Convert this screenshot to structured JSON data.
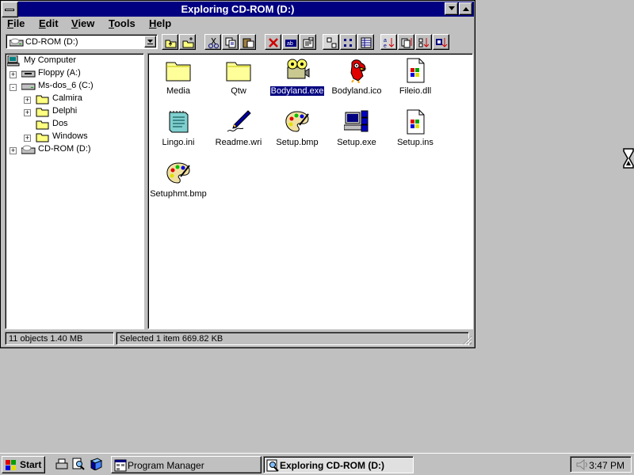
{
  "window": {
    "title": "Exploring CD-ROM (D:)",
    "accent": "#000080"
  },
  "menu": [
    "File",
    "Edit",
    "View",
    "Tools",
    "Help"
  ],
  "toolbar": {
    "drive_value": "CD-ROM (D:)"
  },
  "tree": [
    {
      "label": "My Computer",
      "icon": "computer-icon"
    },
    {
      "label": "Floppy (A:)",
      "icon": "floppy-drive-icon"
    },
    {
      "label": "Ms-dos_6 (C:)",
      "icon": "hard-drive-icon"
    },
    {
      "label": "Calmira",
      "icon": "folder-icon"
    },
    {
      "label": "Delphi",
      "icon": "folder-icon"
    },
    {
      "label": "Dos",
      "icon": "folder-icon"
    },
    {
      "label": "Windows",
      "icon": "folder-icon"
    },
    {
      "label": "CD-ROM (D:)",
      "icon": "cdrom-drive-icon"
    }
  ],
  "files": [
    {
      "label": "Media",
      "icon": "folder-icon"
    },
    {
      "label": "Qtw",
      "icon": "folder-icon"
    },
    {
      "label": "Bodyland.exe",
      "icon": "projector-icon",
      "selected": true
    },
    {
      "label": "Bodyland.ico",
      "icon": "bird-icon"
    },
    {
      "label": "Fileio.dll",
      "icon": "dll-file-icon"
    },
    {
      "label": "Lingo.ini",
      "icon": "notepad-icon"
    },
    {
      "label": "Readme.wri",
      "icon": "write-pen-icon"
    },
    {
      "label": "Setup.bmp",
      "icon": "paint-palette-icon"
    },
    {
      "label": "Setup.exe",
      "icon": "setup-computer-icon"
    },
    {
      "label": "Setup.ins",
      "icon": "ins-file-icon"
    },
    {
      "label": "Setuphmt.bmp",
      "icon": "paint-palette-icon"
    }
  ],
  "status": {
    "objects": "11 objects  1.40 MB",
    "selected": "Selected 1 item  669.82 KB"
  },
  "taskbar": {
    "start_label": "Start",
    "tasks": [
      "Program Manager",
      "Exploring CD-ROM (D:)"
    ],
    "clock": "3:47 PM"
  }
}
